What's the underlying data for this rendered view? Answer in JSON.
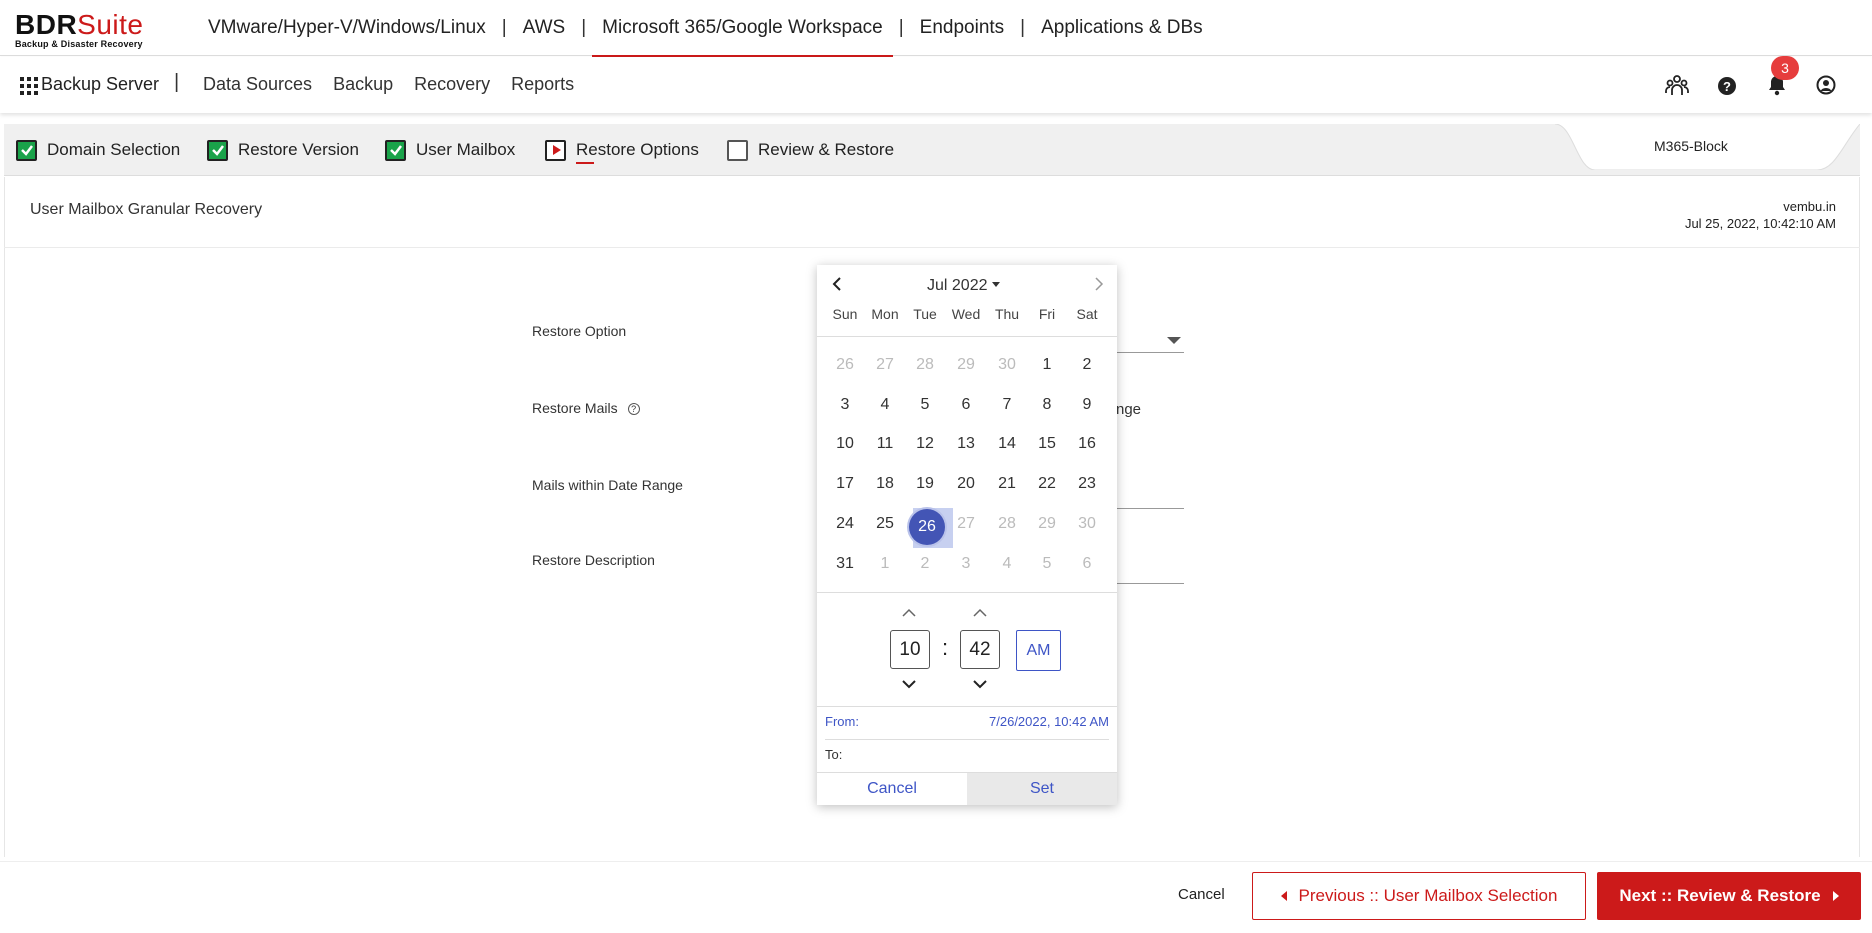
{
  "brand": {
    "name_a": "BDR",
    "name_b": "Suite",
    "tagline": "Backup & Disaster Recovery"
  },
  "top_nav": {
    "items": [
      "VMware/Hyper-V/Windows/Linux",
      "AWS",
      "Microsoft 365/Google Workspace",
      "Endpoints",
      "Applications & DBs"
    ],
    "separator": "|",
    "active": "Microsoft 365/Google Workspace"
  },
  "secondary_nav": {
    "server_label": "Backup Server",
    "separator": "|",
    "items": [
      "Data Sources",
      "Backup",
      "Recovery",
      "Reports"
    ],
    "notification_count": "3"
  },
  "wizard": {
    "steps": [
      {
        "label": "Domain Selection",
        "state": "done"
      },
      {
        "label": "Restore Version",
        "state": "done"
      },
      {
        "label": "User Mailbox",
        "state": "done"
      },
      {
        "label": "Restore Options",
        "state": "current"
      },
      {
        "label": "Review & Restore",
        "state": "pending"
      }
    ],
    "backup_job": "M365-Block"
  },
  "header": {
    "title": "User Mailbox Granular Recovery",
    "domain": "vembu.in",
    "timestamp": "Jul 25, 2022, 10:42:10 AM"
  },
  "form": {
    "restore_option_label": "Restore Option",
    "restore_mails_label": "Restore Mails",
    "restore_mails_help": "?",
    "restore_mails_partial": "nge",
    "date_range_label": "Mails within Date Range",
    "description_label": "Restore Description"
  },
  "calendar": {
    "month_label": "Jul 2022",
    "weekdays": [
      "Sun",
      "Mon",
      "Tue",
      "Wed",
      "Thu",
      "Fri",
      "Sat"
    ],
    "weeks": [
      [
        "26",
        "27",
        "28",
        "29",
        "30",
        "1",
        "2"
      ],
      [
        "3",
        "4",
        "5",
        "6",
        "7",
        "8",
        "9"
      ],
      [
        "10",
        "11",
        "12",
        "13",
        "14",
        "15",
        "16"
      ],
      [
        "17",
        "18",
        "19",
        "20",
        "21",
        "22",
        "23"
      ],
      [
        "24",
        "25",
        "26",
        "27",
        "28",
        "29",
        "30"
      ],
      [
        "31",
        "1",
        "2",
        "3",
        "4",
        "5",
        "6"
      ]
    ],
    "selected_day": "26",
    "hour": "10",
    "minute": "42",
    "meridiem": "AM",
    "from_label": "From:",
    "from_value": "7/26/2022, 10:42 AM",
    "to_label": "To:",
    "cancel_label": "Cancel",
    "set_label": "Set"
  },
  "footer": {
    "cancel_label": "Cancel",
    "prev_label": "Previous :: User Mailbox Selection",
    "next_label": "Next :: Review & Restore"
  },
  "colors": {
    "brand_red": "#cc1a1a",
    "accent_blue": "#3e55c6",
    "check_green": "#1aa34a"
  }
}
